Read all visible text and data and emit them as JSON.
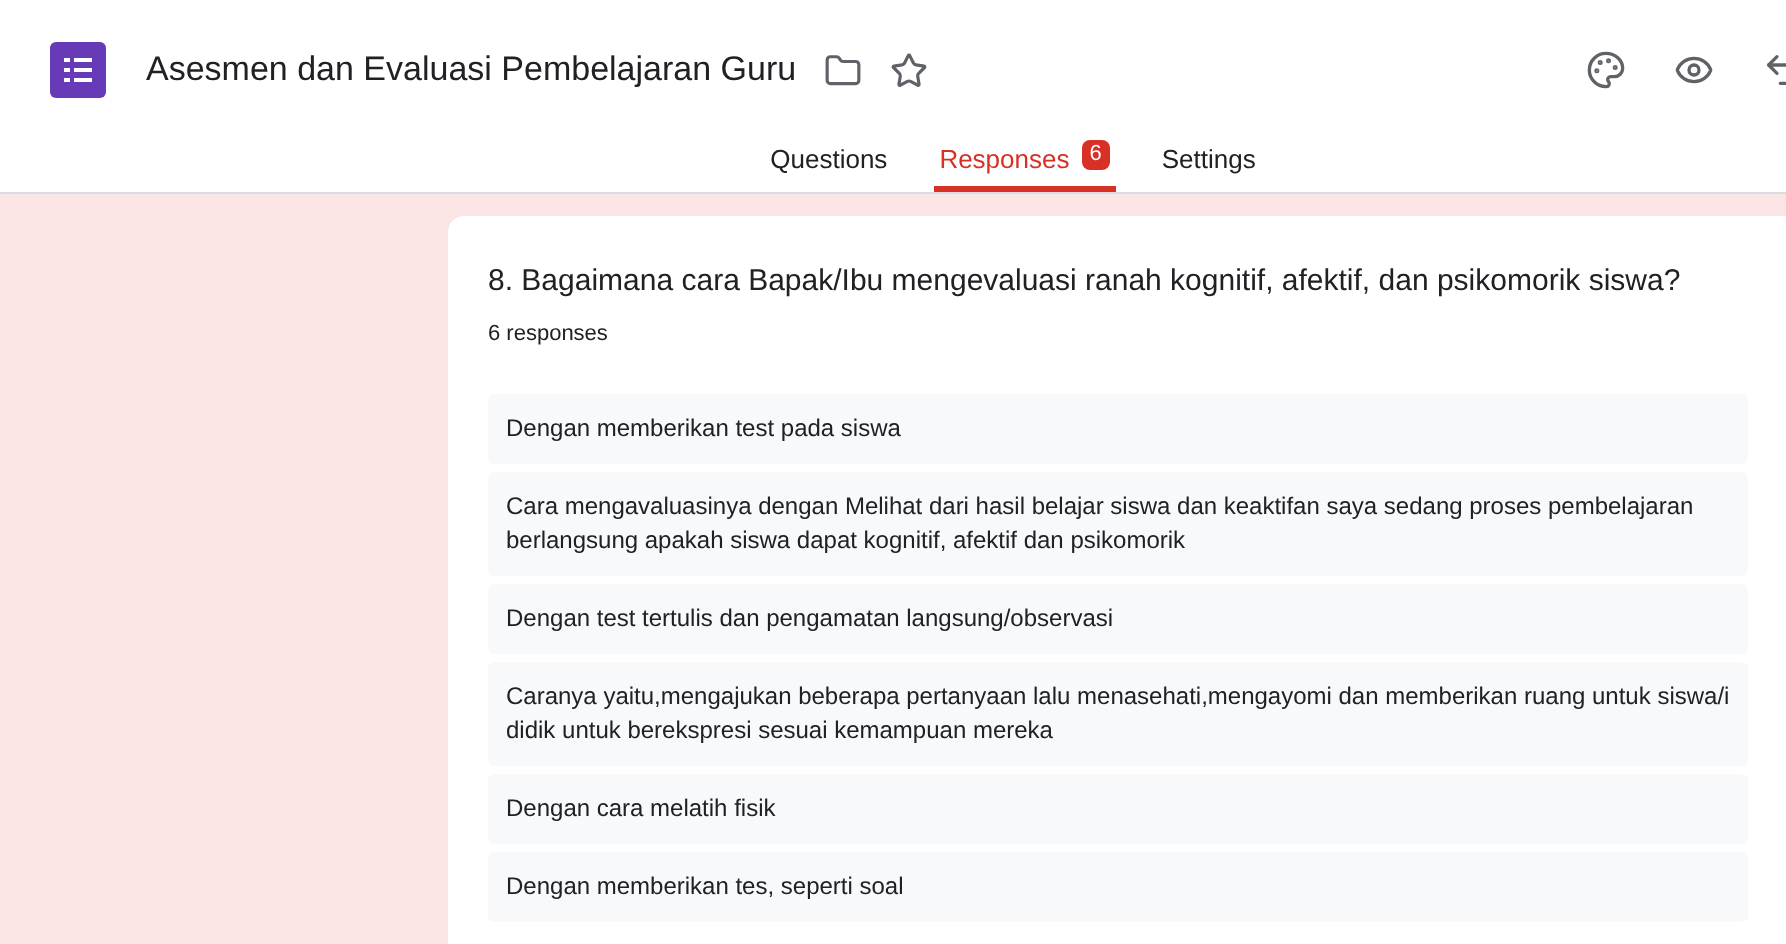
{
  "header": {
    "title": "Asesmen dan Evaluasi Pembelajaran Guru"
  },
  "tabs": [
    {
      "label": "Questions",
      "selected": false
    },
    {
      "label": "Responses",
      "selected": true,
      "badge": "6"
    },
    {
      "label": "Settings",
      "selected": false
    }
  ],
  "question": {
    "title": "8. Bagaimana cara Bapak/Ibu mengevaluasi ranah kognitif, afektif, dan psikomorik siswa?",
    "count": "6 responses",
    "answers": [
      "Dengan memberikan test pada siswa",
      "Cara mengavaluasinya dengan Melihat dari hasil belajar siswa dan keaktifan saya sedang proses pembelajaran berlangsung apakah siswa dapat kognitif, afektif dan psikomorik",
      "Dengan test tertulis dan pengamatan langsung/observasi",
      "Caranya yaitu,mengajukan beberapa pertanyaan lalu menasehati,mengayomi dan memberikan ruang untuk siswa/i didik untuk berekspresi sesuai kemampuan mereka",
      "Dengan cara melatih fisik",
      "Dengan memberikan tes, seperti soal"
    ]
  }
}
